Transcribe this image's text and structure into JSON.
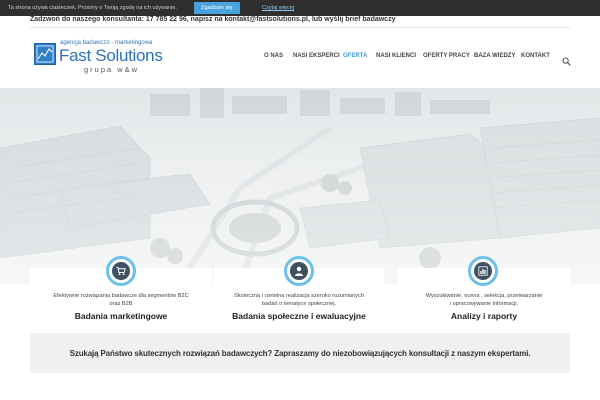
{
  "cookie_bar": {
    "text": "Ta strona używa ciasteczek. Prosimy o Twoją zgodę na ich używanie.",
    "accept_label": "Zgadzam się",
    "more_label": "Czytaj więcej"
  },
  "contact": {
    "text": "Zadzwoń do naszego konsultanta: 17 785 22 96, napisz na kontakt@fastsolutions.pl, lub wyślij brief badawczy"
  },
  "logo": {
    "tagline": "agencja badawczo - marketingowa",
    "name": "Fast Solutions",
    "group": "grupa w&w"
  },
  "nav": {
    "items": [
      {
        "label": "O NAS"
      },
      {
        "label": "NASI EKSPERCI"
      },
      {
        "label": "OFERTA"
      },
      {
        "label": "NASI KLIENCI"
      },
      {
        "label": "OFERTY PRACY"
      },
      {
        "label": "BAZA WIEDZY"
      },
      {
        "label": "KONTAKT"
      }
    ],
    "active": "OFERTA",
    "search_icon": "search-icon"
  },
  "cards": [
    {
      "icon": "cart-icon",
      "desc_line1": "Efektywne rozwiązania badawcze dla segmentów B2C",
      "desc_line2": "oraz B2B",
      "title": "Badania marketingowe"
    },
    {
      "icon": "user-icon",
      "desc_line1": "Skuteczna i rzetelna realizacja szeroko rozumianych",
      "desc_line2": "badań o tematyce społecznej.",
      "title": "Badania społeczne i ewaluacyjne"
    },
    {
      "icon": "bar-chart-icon",
      "desc_line1": "Wyszukiwanie, ocena , selekcja, przetwarzanie",
      "desc_line2": "i opracowywanie informacji.",
      "title": "Analizy i raporty"
    }
  ],
  "cta": {
    "text": "Szukają Państwo skutecznych rozwiązań badawczych? Zapraszamy do niezobowiązujących konsultacji z naszym ekspertami."
  },
  "colors": {
    "accent": "#3a9ad9",
    "icon_ring": "#6cc0ea",
    "icon_fill": "#3f5063",
    "cookie_bg": "#2f2f2f",
    "cta_bg": "#f0f0f0"
  }
}
